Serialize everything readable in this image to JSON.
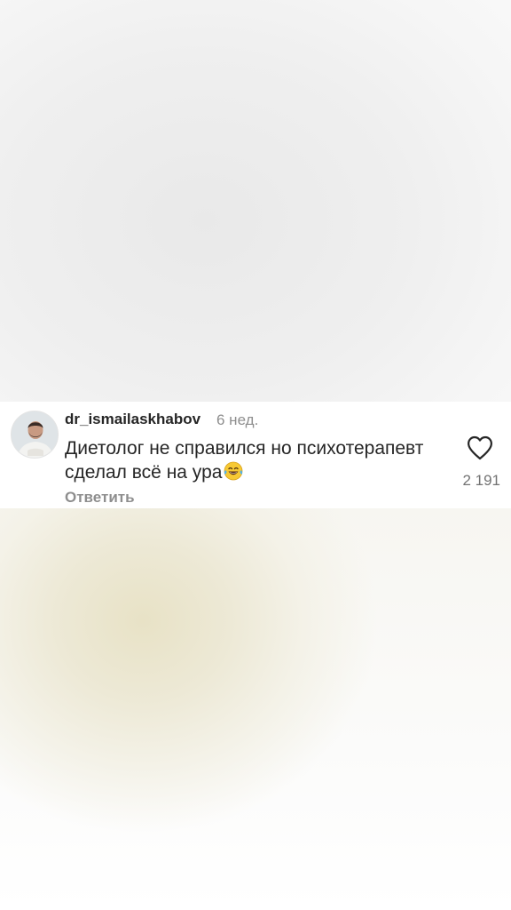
{
  "comment": {
    "username": "dr_ismailaskhabov",
    "time": "6 нед.",
    "text": "Диетолог не справился но психотерапевт сделал всё на ура",
    "emoji": "tears-of-joy-emoji",
    "reply_label": "Ответить",
    "likes": "2 191"
  }
}
